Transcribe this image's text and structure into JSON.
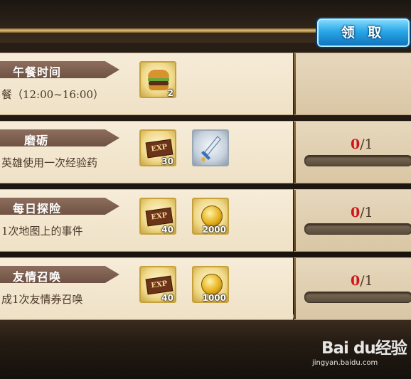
{
  "tasks": [
    {
      "title": "午餐时间",
      "description": "餐（12:00~16:00）",
      "rewards": [
        {
          "icon": "hamburger-icon",
          "qty": "2"
        }
      ],
      "action": {
        "type": "claim",
        "label": "领 取"
      }
    },
    {
      "title": "磨砺",
      "description": "英雄使用一次经验药",
      "rewards": [
        {
          "icon": "exp-potion-icon",
          "qty": "30"
        },
        {
          "icon": "sword-icon",
          "qty": ""
        }
      ],
      "progress": {
        "current": "0",
        "separator": "/",
        "total": "1",
        "fraction": 0
      }
    },
    {
      "title": "每日探险",
      "description": "1次地图上的事件",
      "rewards": [
        {
          "icon": "exp-potion-icon",
          "qty": "40"
        },
        {
          "icon": "gold-coin-icon",
          "qty": "2000"
        }
      ],
      "progress": {
        "current": "0",
        "separator": "/",
        "total": "1",
        "fraction": 0
      }
    },
    {
      "title": "友情召唤",
      "description": "成1次友情券召唤",
      "rewards": [
        {
          "icon": "exp-potion-icon",
          "qty": "40"
        },
        {
          "icon": "gold-coin-icon",
          "qty": "1000"
        }
      ],
      "progress": {
        "current": "0",
        "separator": "/",
        "total": "1",
        "fraction": 0
      }
    }
  ],
  "icon_labels": {
    "exp": "EXP"
  },
  "watermark": {
    "brand": "Bai du经验",
    "url": "jingyan.baidu.com"
  },
  "colors": {
    "accent": "#d0151a",
    "claim_button": "#2aa7e8",
    "panel": "#f6ecd8"
  }
}
